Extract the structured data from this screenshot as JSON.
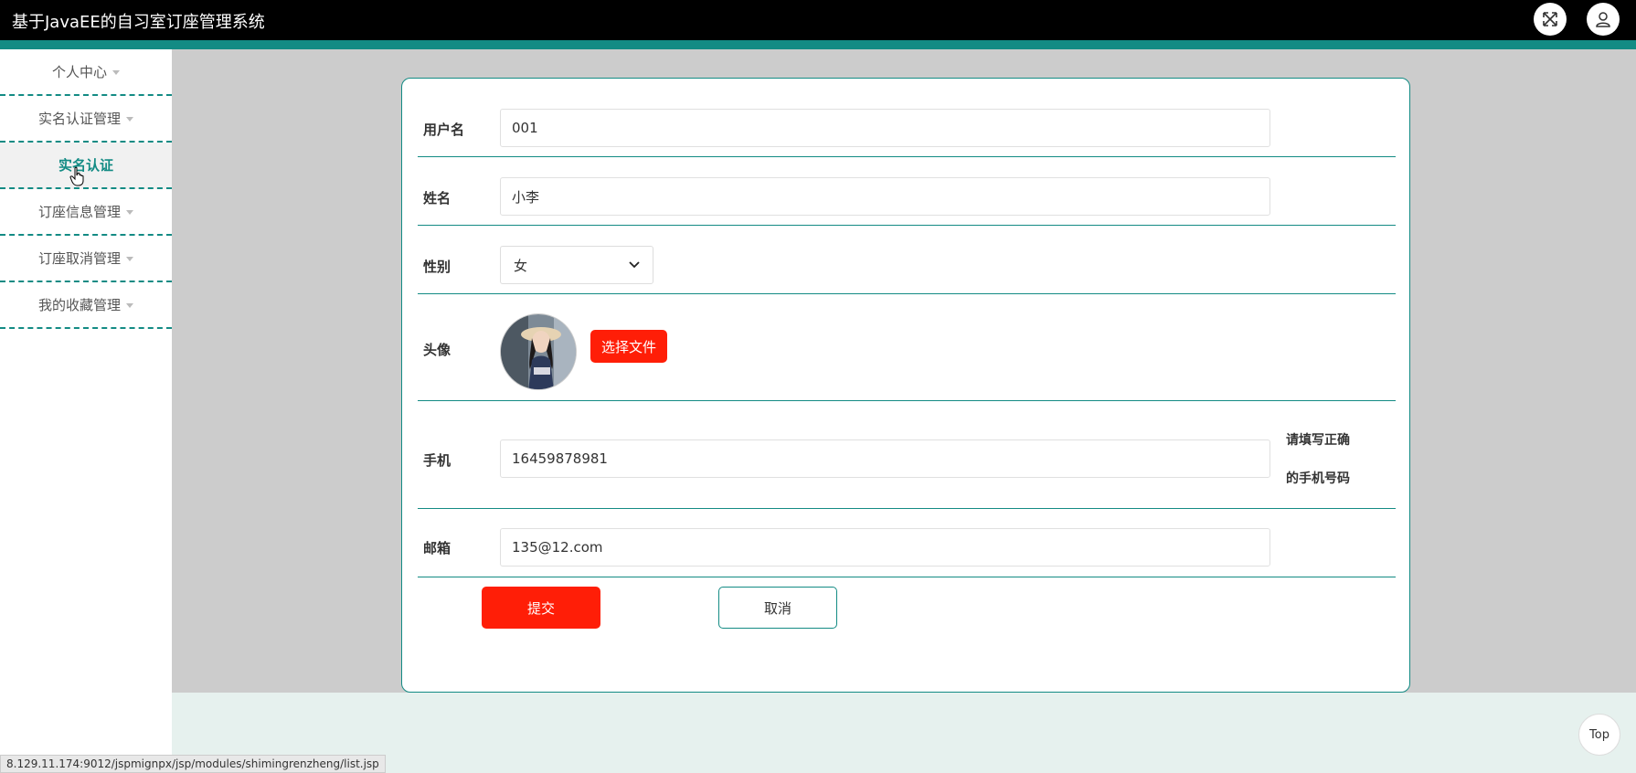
{
  "header": {
    "title": "基于JavaEE的自习室订座管理系统",
    "fullscreen_icon": "fullscreen-icon",
    "user_icon": "user-icon"
  },
  "sidebar": {
    "items": [
      {
        "label": "个人中心",
        "expandable": true
      },
      {
        "label": "实名认证管理",
        "expandable": true
      },
      {
        "label": "实名认证",
        "expandable": false,
        "active": true
      },
      {
        "label": "订座信息管理",
        "expandable": true
      },
      {
        "label": "订座取消管理",
        "expandable": true
      },
      {
        "label": "我的收藏管理",
        "expandable": true
      }
    ]
  },
  "form": {
    "username": {
      "label": "用户名",
      "value": "001"
    },
    "name": {
      "label": "姓名",
      "value": "小李"
    },
    "gender": {
      "label": "性别",
      "value": "女"
    },
    "avatar": {
      "label": "头像",
      "button_label": "选择文件"
    },
    "phone": {
      "label": "手机",
      "value": "16459878981",
      "hint_line1": "请填写正确",
      "hint_line2": "的手机号码"
    },
    "email": {
      "label": "邮箱",
      "value": "135@12.com"
    },
    "submit_label": "提交",
    "cancel_label": "取消"
  },
  "top_button_label": "Top",
  "status_url": "8.129.11.174:9012/jspmignpx/jsp/modules/shimingrenzheng/list.jsp",
  "colors": {
    "accent": "#138b84",
    "primary_button": "#ff1e07",
    "header_bg": "#000000",
    "content_bg": "#cccccc"
  }
}
